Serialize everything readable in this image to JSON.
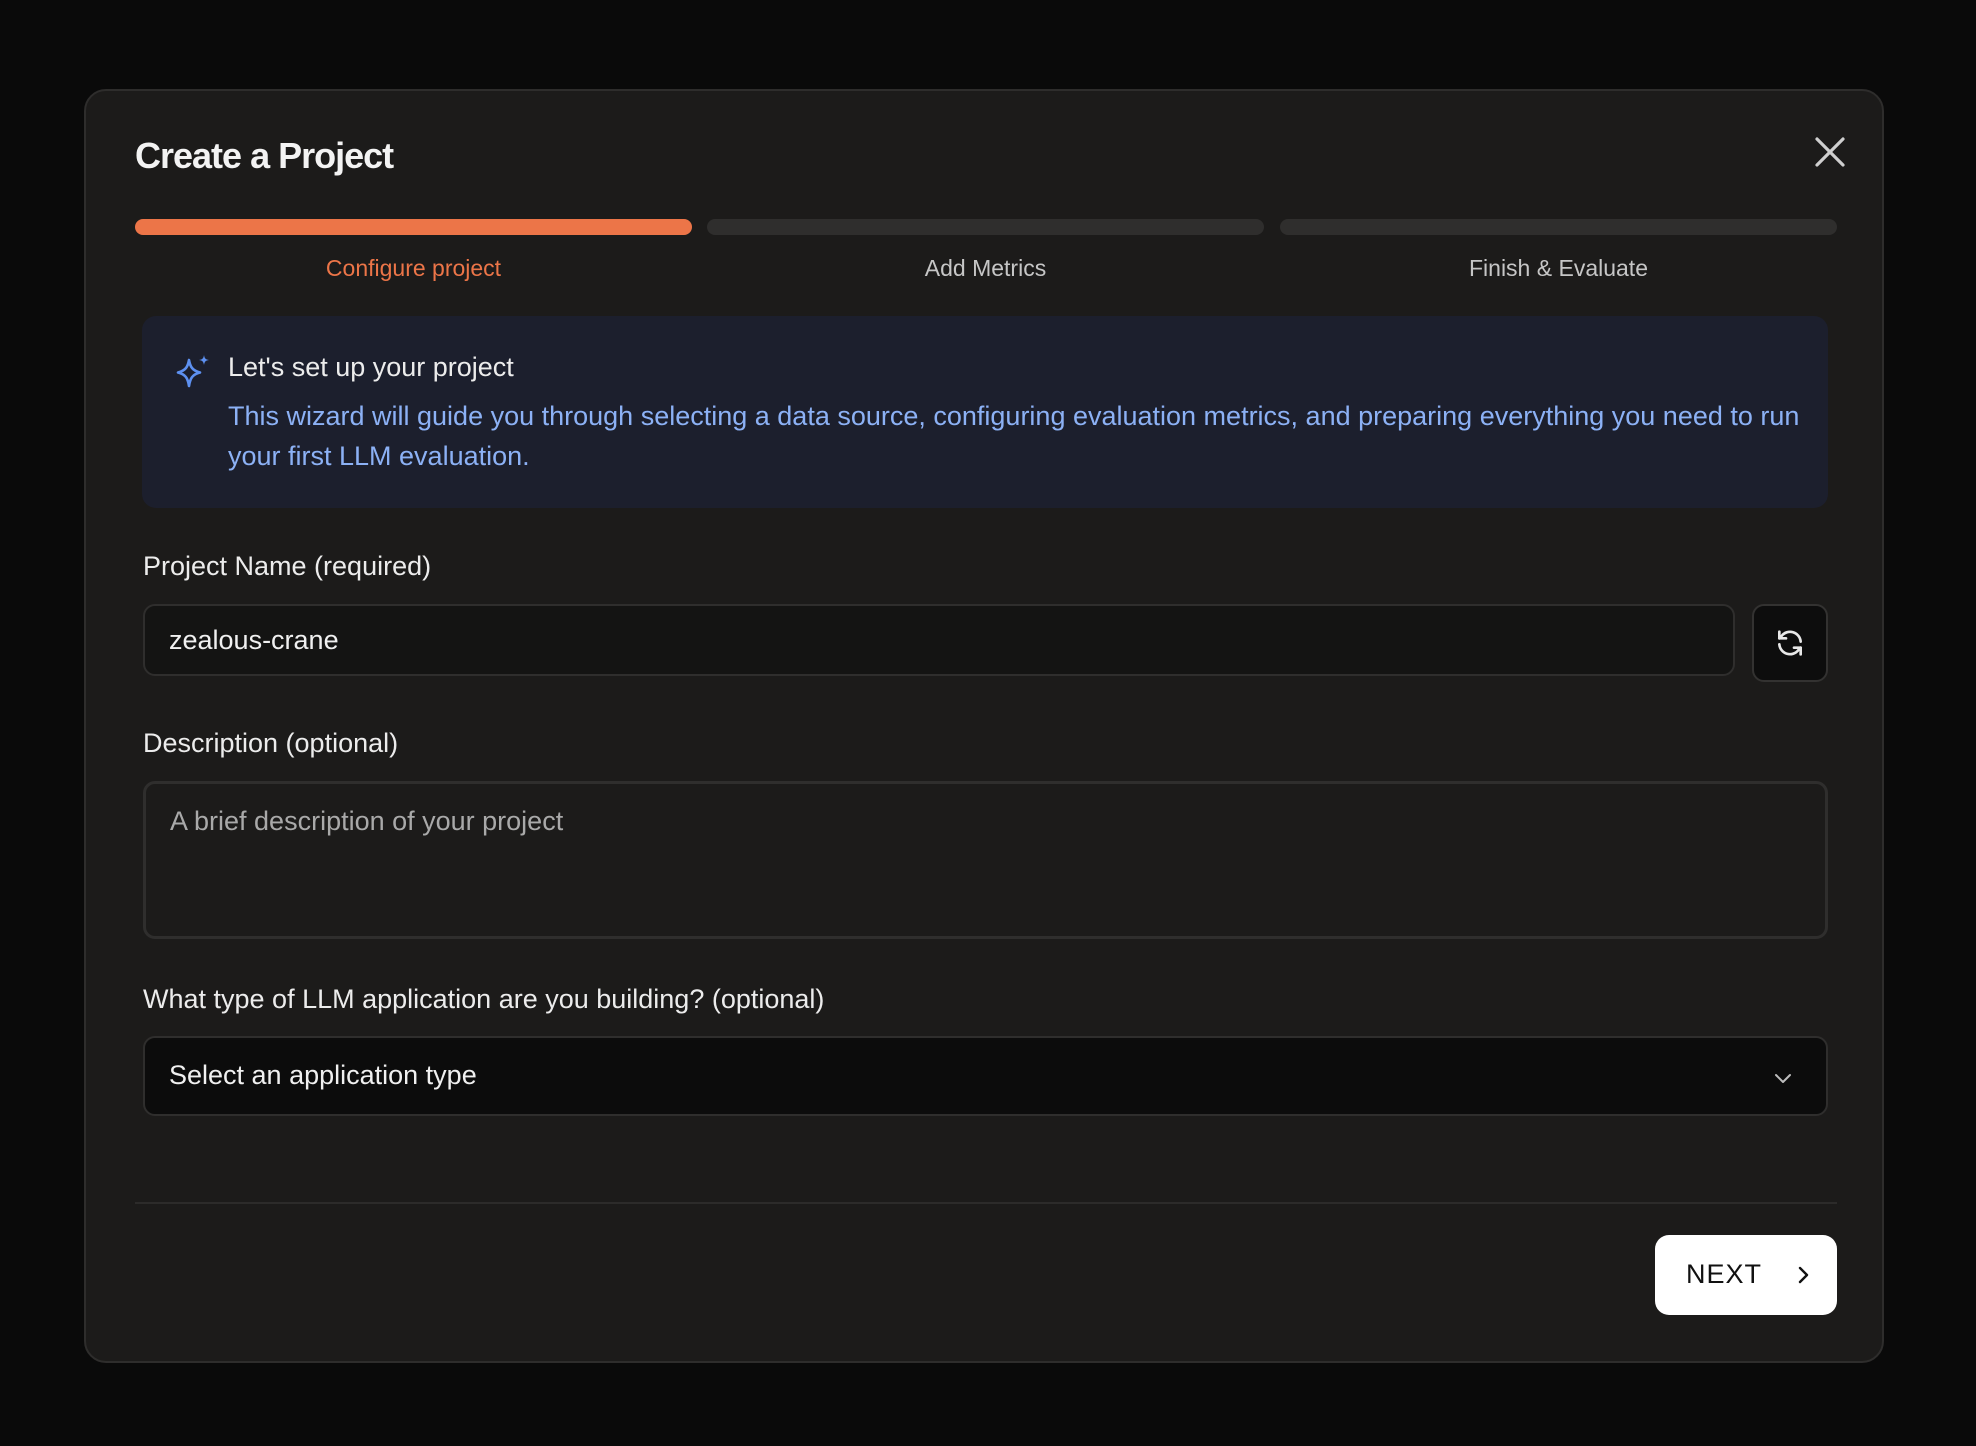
{
  "dialog": {
    "title": "Create a Project",
    "close_icon": "close-icon"
  },
  "steps": [
    {
      "label": "Configure project",
      "active": true
    },
    {
      "label": "Add Metrics",
      "active": false
    },
    {
      "label": "Finish & Evaluate",
      "active": false
    }
  ],
  "info": {
    "icon": "sparkle-icon",
    "title": "Let's set up your project",
    "text": "This wizard will guide you through selecting a data source, configuring evaluation metrics, and preparing everything you need to run your first LLM evaluation."
  },
  "form": {
    "name_label": "Project Name (required)",
    "name_value": "zealous-crane",
    "refresh_icon": "refresh-icon",
    "description_label": "Description (optional)",
    "description_placeholder": "A brief description of your project",
    "app_type_label": "What type of LLM application are you building? (optional)",
    "app_type_value": "Select an application type"
  },
  "footer": {
    "next_label": "NEXT"
  },
  "colors": {
    "accent": "#ec7548",
    "info_text": "#8cb1f5",
    "info_bg": "#1c1f2d",
    "modal_bg": "#1c1b1a"
  }
}
